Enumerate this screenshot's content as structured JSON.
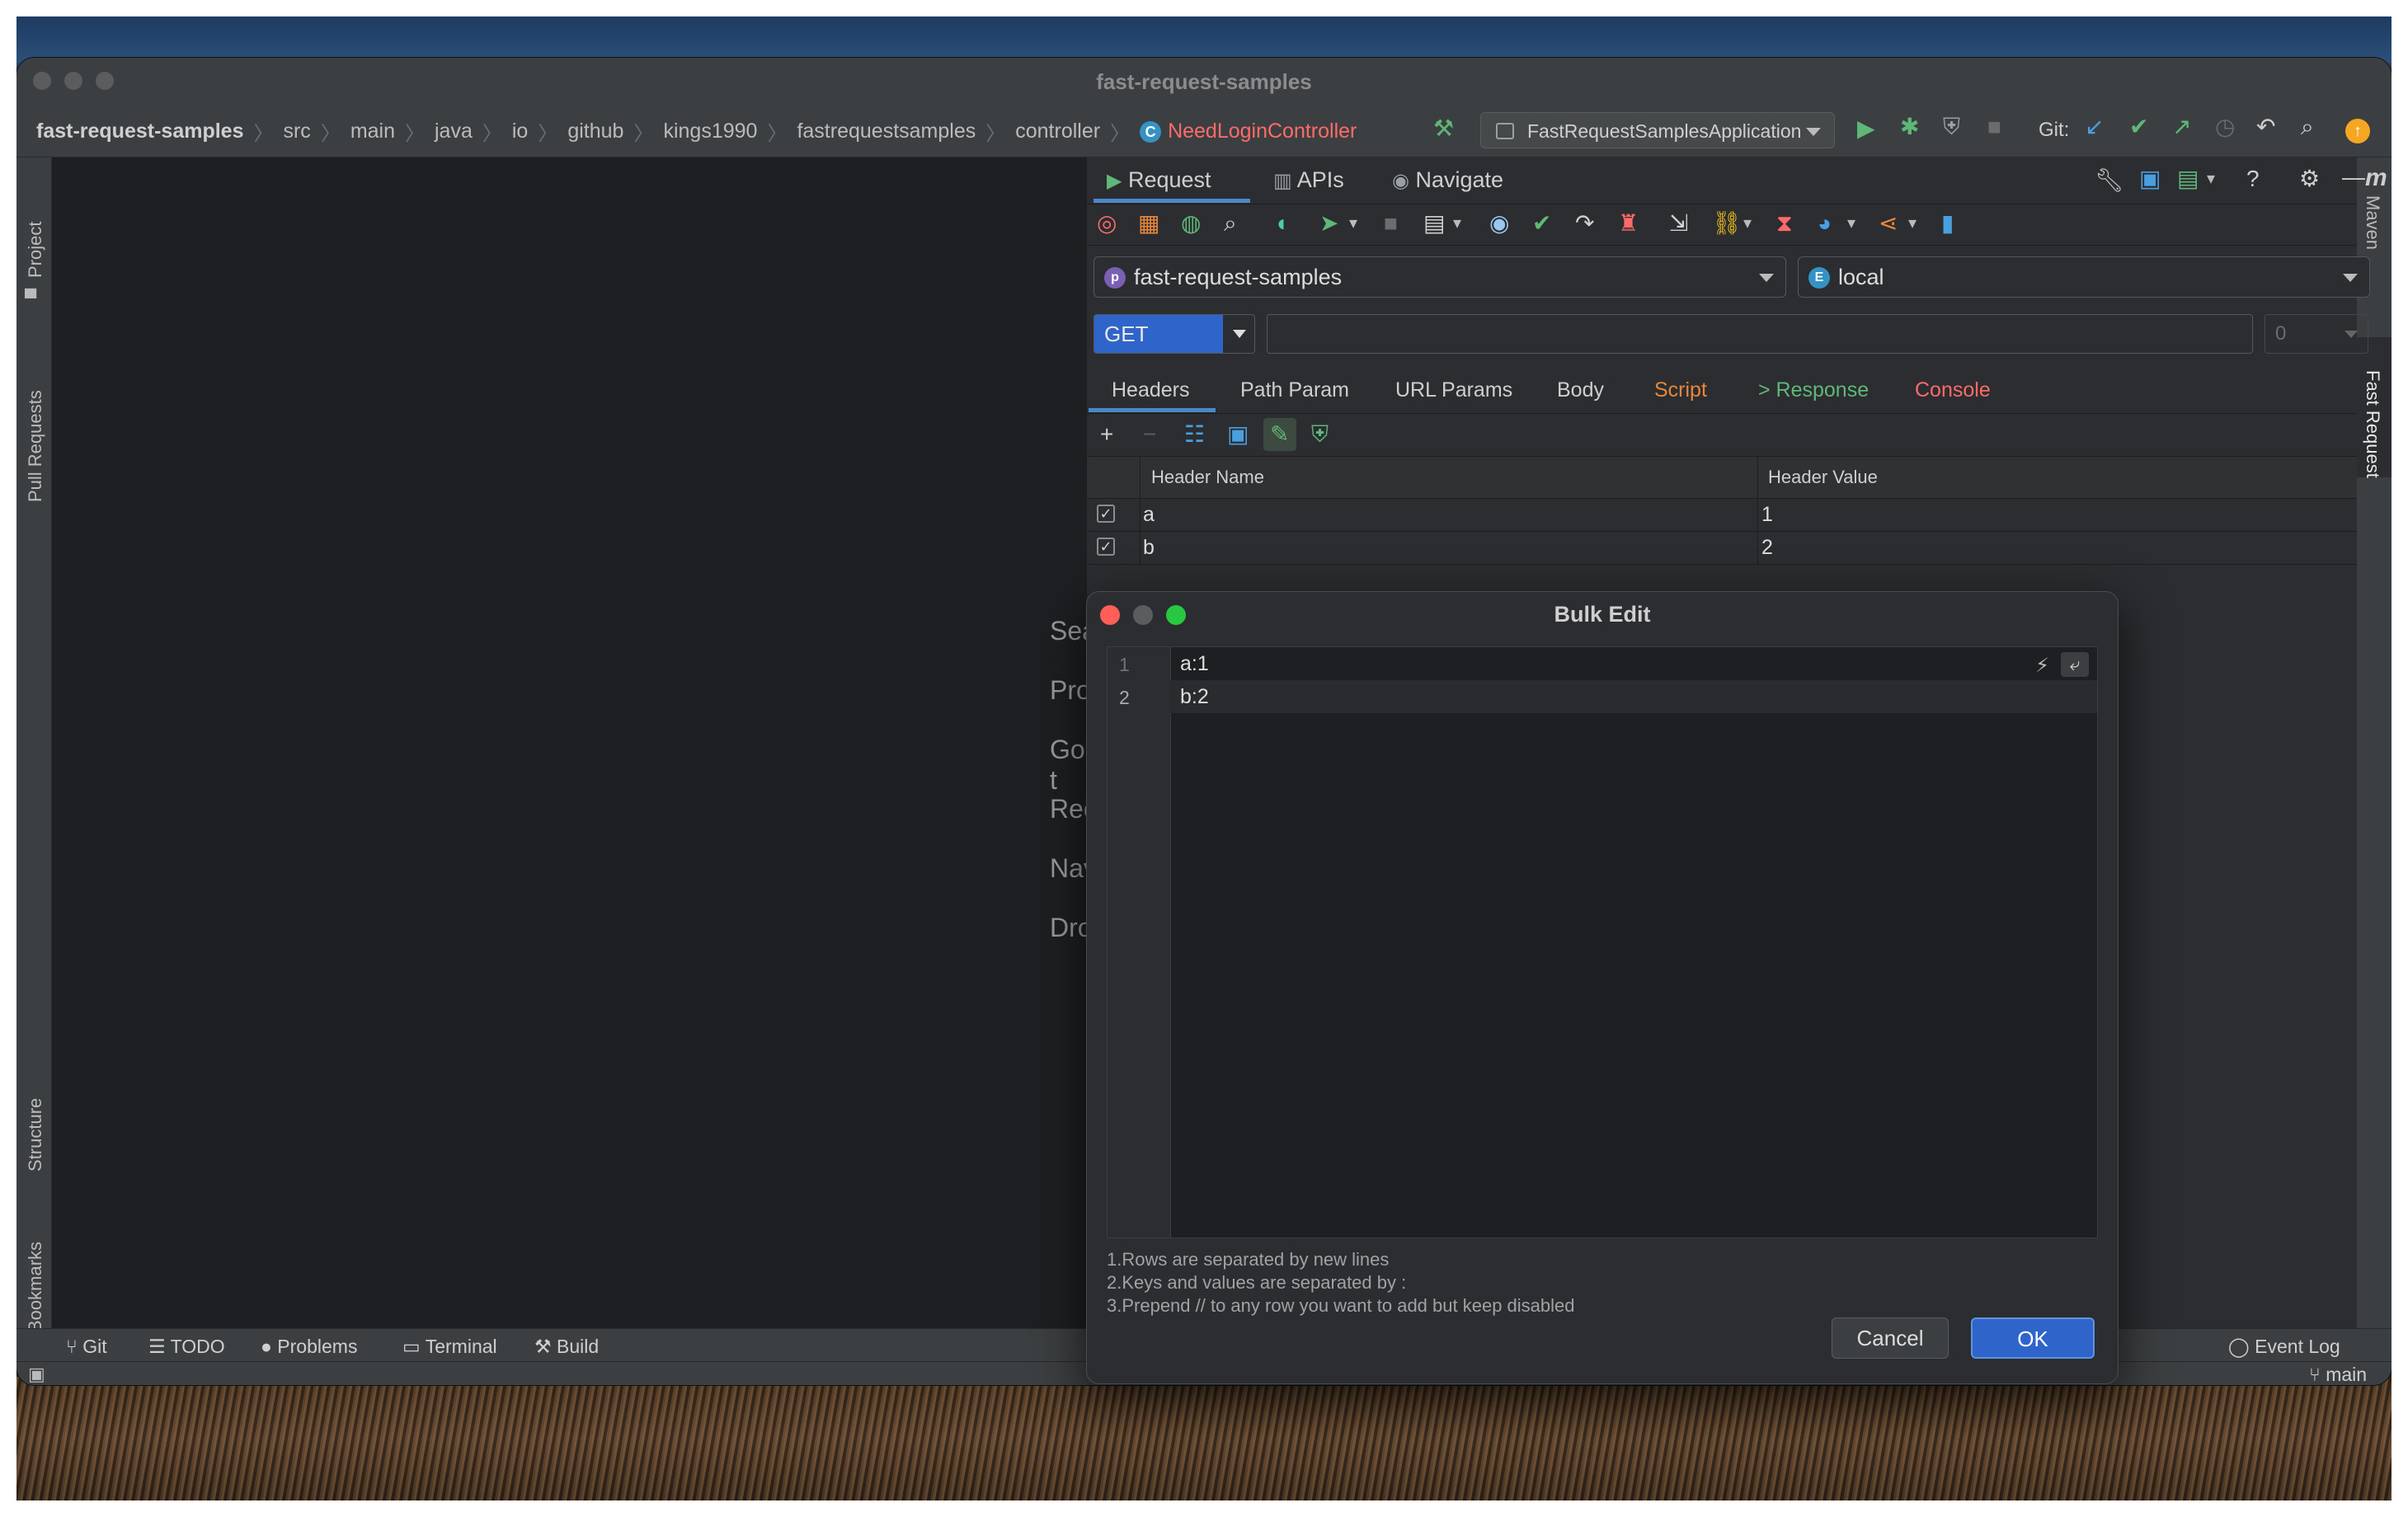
{
  "window": {
    "title": "fast-request-samples"
  },
  "breadcrumbs": [
    "fast-request-samples",
    "src",
    "main",
    "java",
    "io",
    "github",
    "kings1990",
    "fastrequestsamples",
    "controller"
  ],
  "breadcrumb_current": "NeedLoginController",
  "run_config": "FastRequestSamplesApplication",
  "git_label": "Git:",
  "left_tools": {
    "project": "Project",
    "pull_requests": "Pull Requests",
    "structure": "Structure",
    "bookmarks": "Bookmarks"
  },
  "right_tools": {
    "maven": "Maven",
    "fast_request": "Fast Request"
  },
  "editor_hints": [
    "Sear",
    "Proj",
    "Go t",
    "Rece",
    "Navi",
    "Drop"
  ],
  "panel": {
    "tabs": {
      "request": "Request",
      "apis": "APIs",
      "navigate": "Navigate"
    },
    "project_combo": "fast-request-samples",
    "env_combo": "local",
    "method": "GET",
    "url": "",
    "number": "0",
    "subtabs": {
      "headers": "Headers",
      "path_param": "Path Param",
      "url_params": "URL Params",
      "body": "Body",
      "script": "Script",
      "response": "> Response",
      "console": "Console"
    },
    "table": {
      "col_name": "Header Name",
      "col_value": "Header Value",
      "rows": [
        {
          "name": "a",
          "value": "1",
          "checked": true
        },
        {
          "name": "b",
          "value": "2",
          "checked": true
        }
      ]
    }
  },
  "status_bar": {
    "git": "Git",
    "todo": "TODO",
    "problems": "Problems",
    "terminal": "Terminal",
    "build": "Build",
    "event_log": "Event Log",
    "branch": "main"
  },
  "dialog": {
    "title": "Bulk Edit",
    "lines": [
      "a:1",
      "b:2"
    ],
    "line_numbers": [
      "1",
      "2"
    ],
    "help": [
      "1.Rows are separated by new lines",
      "2.Keys and values are separated by :",
      "3.Prepend // to any row you want to add but keep disabled"
    ],
    "cancel": "Cancel",
    "ok": "OK"
  },
  "colors": {
    "accent": "#2f65ca",
    "script_tab": "#e8873a",
    "response_tab": "#5fb878",
    "console_tab": "#ff6b68",
    "current_file": "#ff6b68"
  }
}
